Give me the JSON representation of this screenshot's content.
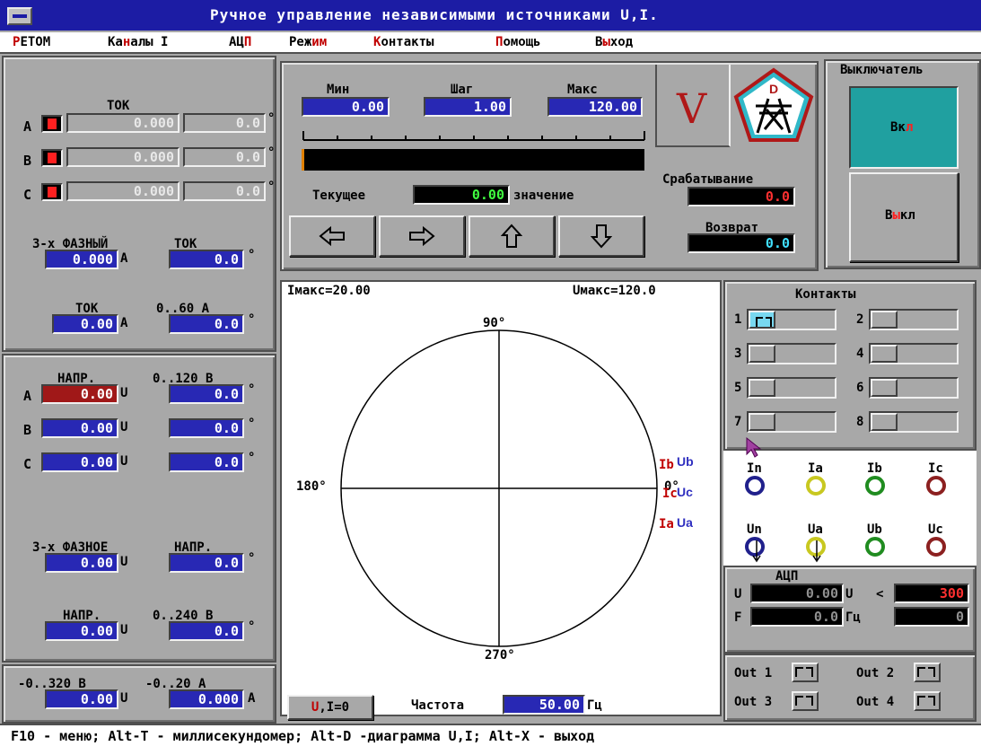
{
  "window": {
    "title": "Ручное управление независимыми источниками U,I."
  },
  "menu": [
    {
      "first": "Р",
      "rest": "ЕТОМ"
    },
    {
      "pre": "Ка",
      "hk": "н",
      "post": "алы I"
    },
    {
      "pre": "АЦ",
      "hk": "П",
      "post": ""
    },
    {
      "pre": "Реж",
      "hk": "им",
      "post": ""
    },
    {
      "pre": "",
      "hk": "К",
      "post": "онтакты"
    },
    {
      "pre": "",
      "hk": "П",
      "post": "омощь"
    },
    {
      "pre": "В",
      "hk": "ы",
      "post": "ход"
    }
  ],
  "current": {
    "title": "ТОК",
    "rows": [
      {
        "phase": "A",
        "indicator": "0",
        "amp": "0.000",
        "angle": "0.0",
        "deg": "°"
      },
      {
        "phase": "B",
        "indicator": "0",
        "amp": "0.000",
        "angle": "0.0",
        "deg": "°"
      },
      {
        "phase": "C",
        "indicator": "0",
        "amp": "0.000",
        "angle": "0.0",
        "deg": "°"
      }
    ],
    "three_phase": {
      "label1": "3-х ФАЗНЫЙ",
      "label2": "ТОК",
      "amp": "0.000",
      "unit": "A",
      "angle": "0.0",
      "deg": "°"
    },
    "range": {
      "label1": "ТОК",
      "label2": "0..60 А",
      "amp": "0.00",
      "unit": "A",
      "angle": "0.0",
      "deg": "°"
    }
  },
  "voltage": {
    "title1": "НАПР.",
    "title2": "0..120 В",
    "rows": [
      {
        "phase": "A",
        "value": "0.00",
        "unit": "U",
        "angle": "0.0",
        "deg": "°"
      },
      {
        "phase": "B",
        "value": "0.00",
        "unit": "U",
        "angle": "0.0",
        "deg": "°"
      },
      {
        "phase": "C",
        "value": "0.00",
        "unit": "U",
        "angle": "0.0",
        "deg": "°"
      }
    ],
    "three_phase": {
      "label1": "3-х ФАЗНОЕ",
      "label2": "НАПР.",
      "value": "0.00",
      "unit": "U",
      "angle": "0.0",
      "deg": "°"
    },
    "range240": {
      "label1": "НАПР.",
      "label2": "0..240 В",
      "value": "0.00",
      "unit": "U",
      "angle": "0.0",
      "deg": "°"
    },
    "dc": {
      "label1": "-0..320 В",
      "label2": "-0..20 А",
      "value": "0.00",
      "unit": "U",
      "amp": "0.000",
      "aunit": "A"
    }
  },
  "regulator": {
    "min_label": "Мин",
    "min": "0.00",
    "step_label": "Шаг",
    "step": "1.00",
    "max_label": "Макс",
    "max": "120.00",
    "current_label": "Текущее",
    "current": "0.00",
    "current_suffix": "значение",
    "mode_letter": "V",
    "progress": 0.0
  },
  "trip": {
    "pickup_label": "Срабатывание",
    "pickup": "0.0",
    "return_label": "Возврат",
    "return": "0.0",
    "logo_letter": "D"
  },
  "breaker": {
    "title": "Выключатель",
    "on_pre": "Вк",
    "on_hk": "л",
    "off_pre": "В",
    "off_hk": "ы",
    "off_post": "кл"
  },
  "diagram": {
    "imax": "Iмакс=20.00",
    "umax": "Uмакс=120.0",
    "a90": "90°",
    "a180": "180°",
    "a270": "270°",
    "a0": "0°",
    "lbl_ib": "Ib",
    "lbl_ub": "Ub",
    "lbl_ic": "Ic",
    "lbl_uc": "Uc",
    "lbl_ia": "Ia",
    "lbl_ua": "Ua"
  },
  "contacts": {
    "title": "Контакты",
    "items": [
      {
        "num": "1",
        "on": true
      },
      {
        "num": "2",
        "on": false
      },
      {
        "num": "3",
        "on": false
      },
      {
        "num": "4",
        "on": false
      },
      {
        "num": "5",
        "on": false
      },
      {
        "num": "6",
        "on": false
      },
      {
        "num": "7",
        "on": false
      },
      {
        "num": "8",
        "on": false
      }
    ]
  },
  "terminals": {
    "currents": [
      {
        "label": "In",
        "color": "#20208c"
      },
      {
        "label": "Ia",
        "color": "#c8c820"
      },
      {
        "label": "Ib",
        "color": "#208c20"
      },
      {
        "label": "Ic",
        "color": "#8c2020"
      }
    ],
    "voltages": [
      {
        "label": "Un",
        "color": "#20208c"
      },
      {
        "label": "Ua",
        "color": "#c8c820"
      },
      {
        "label": "Ub",
        "color": "#208c20"
      },
      {
        "label": "Uc",
        "color": "#8c2020"
      }
    ]
  },
  "adc": {
    "title": "АЦП",
    "u_label": "U",
    "u_value": "0.00",
    "u_unit": "U",
    "cmp": "<",
    "limit": "300",
    "f_label": "F",
    "f_value": "0.0",
    "f_unit": "Гц",
    "f_extra": "0"
  },
  "outputs": [
    "Out 1",
    "Out 2",
    "Out 3",
    "Out 4"
  ],
  "bottom": {
    "zero_btn_hk": "U",
    "zero_btn_rest": ",I=0",
    "freq_label": "Частота",
    "freq": "50.00",
    "freq_unit": "Гц"
  },
  "status": "F10 - меню; Alt-T - миллисекундомер; Alt-D -диаграмма U,I; Alt-X - выход",
  "colors": {
    "accent": "#2828b4",
    "title_bar": "#1c1ca4",
    "breaker_on": "#20a0a0"
  }
}
